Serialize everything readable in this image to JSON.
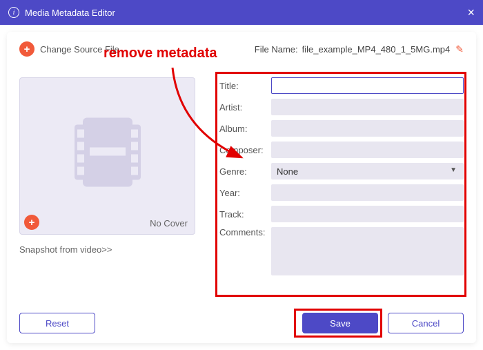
{
  "titlebar": {
    "title": "Media Metadata Editor"
  },
  "toprow": {
    "change_label": "Change Source File",
    "filename_label": "File Name:",
    "filename_value": "file_example_MP4_480_1_5MG.mp4"
  },
  "cover": {
    "nocover_label": "No Cover",
    "snapshot_label": "Snapshot from video>>"
  },
  "form": {
    "title_label": "Title:",
    "artist_label": "Artist:",
    "album_label": "Album:",
    "composer_label": "Composer:",
    "genre_label": "Genre:",
    "genre_value": "None",
    "year_label": "Year:",
    "track_label": "Track:",
    "comments_label": "Comments:"
  },
  "footer": {
    "reset_label": "Reset",
    "save_label": "Save",
    "cancel_label": "Cancel"
  },
  "annotation": {
    "text": "remove metadata"
  }
}
